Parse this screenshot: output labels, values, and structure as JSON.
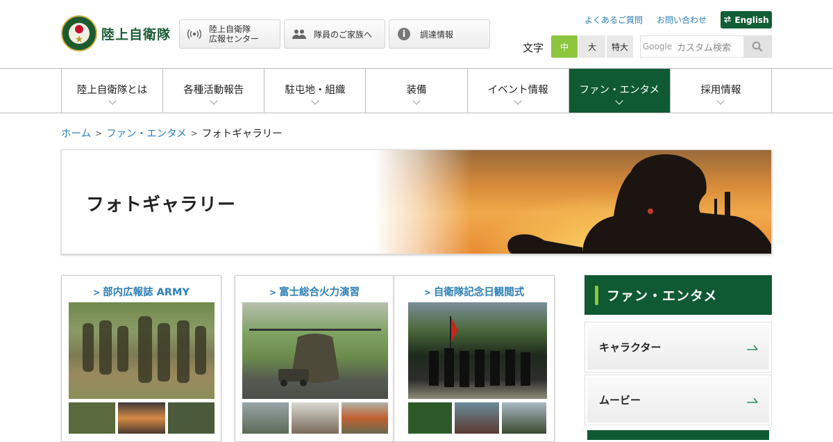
{
  "header": {
    "site_name": "陸上自衛隊",
    "quick_links": [
      {
        "line1": "陸上自衛隊",
        "line2": "広報センター",
        "icon": "radio-wave-icon"
      },
      {
        "label": "隊員のご家族へ",
        "icon": "people-icon"
      },
      {
        "label": "調達情報",
        "icon": "info-icon"
      }
    ],
    "top_links": [
      "よくあるご質問",
      "お問い合わせ"
    ],
    "english_label": "English",
    "font_size": {
      "label": "文字",
      "options": [
        "中",
        "大",
        "特大"
      ],
      "selected": "中"
    },
    "search": {
      "brand": "Google",
      "placeholder": "カスタム検索"
    }
  },
  "nav": [
    {
      "label": "陸上自衛隊とは"
    },
    {
      "label": "各種活動報告"
    },
    {
      "label": "駐屯地・組織"
    },
    {
      "label": "装備"
    },
    {
      "label": "イベント情報"
    },
    {
      "label": "ファン・エンタメ",
      "active": true
    },
    {
      "label": "採用情報"
    }
  ],
  "breadcrumb": {
    "home": "ホーム",
    "parent": "ファン・エンタメ",
    "current": "フォトギャラリー",
    "separator": ">"
  },
  "hero": {
    "title": "フォトギャラリー"
  },
  "gallery": [
    {
      "title": "部内広報誌 ARMY"
    },
    {
      "title": "富士総合火力演習"
    },
    {
      "title": "自衛隊記念日観閲式"
    }
  ],
  "sidebar": {
    "title": "ファン・エンタメ",
    "items": [
      {
        "label": "キャラクター"
      },
      {
        "label": "ムービー"
      }
    ]
  },
  "colors": {
    "brand_green": "#0f5a32",
    "accent_lime": "#8cc63f",
    "link_blue": "#2d7fb8"
  }
}
